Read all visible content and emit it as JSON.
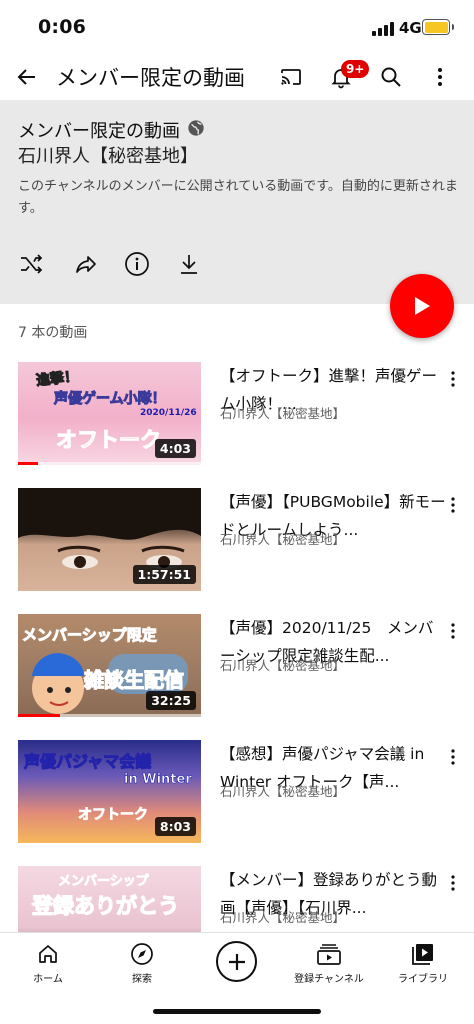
{
  "status_bar": {
    "time": "0:06",
    "network": "4G"
  },
  "app_bar": {
    "title": "メンバー限定の動画",
    "notification_badge": "9+"
  },
  "playlist": {
    "title": "メンバー限定の動画",
    "channel": "石川界人【秘密基地】",
    "description": "このチャンネルのメンバーに公開されている動画です。自動的に更新されます。",
    "video_count": "7 本の動画"
  },
  "thumb_texts": {
    "v1_line1": "進撃！",
    "v1_line2": "声優ゲーム小隊！",
    "v1_date": "2020/11/26",
    "v1_main": "オフトーク",
    "v3_line1": "メンバーシップ限定",
    "v3_line2": "雑談生配信",
    "v4_line1": "声優パジャマ会議",
    "v4_line2": "in Winter",
    "v4_line3": "オフトーク",
    "v5_line1": "メンバーシップ",
    "v5_line2": "登録ありがとう"
  },
  "videos": [
    {
      "title": "【オフトーク】進撃！声優ゲーム小隊！...",
      "channel": "石川界人【秘密基地】",
      "duration": "4:03",
      "progress": 0.11
    },
    {
      "title": "【声優】【PUBGMobile】新モードとルームしよう...",
      "channel": "石川界人【秘密基地】",
      "duration": "1:57:51",
      "progress": 0
    },
    {
      "title": "【声優】2020/11/25　メンバーシップ限定雑談生配...",
      "channel": "石川界人【秘密基地】",
      "duration": "32:25",
      "progress": 0.23
    },
    {
      "title": "【感想】声優パジャマ会議 in Winter オフトーク【声...",
      "channel": "石川界人【秘密基地】",
      "duration": "8:03",
      "progress": 0
    },
    {
      "title": "【メンバー】登録ありがとう動画【声優】【石川界...",
      "channel": "石川界人【秘密基地】",
      "duration": "",
      "progress": 0
    }
  ],
  "bottom_nav": {
    "home": "ホーム",
    "explore": "探索",
    "subscriptions": "登録チャンネル",
    "library": "ライブラリ"
  },
  "colors": {
    "accent": "#ff0000",
    "header_bg": "#e9e9e9",
    "battery": "#f6c722"
  }
}
